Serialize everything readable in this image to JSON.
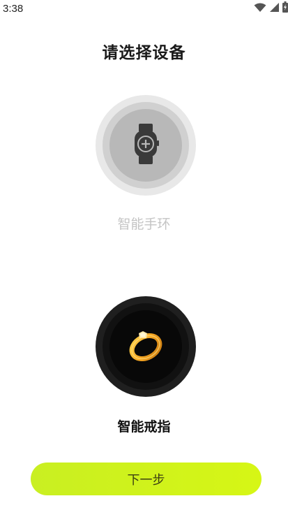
{
  "status_bar": {
    "time": "3:38",
    "icons": [
      "wifi-icon",
      "cellular-signal-icon",
      "battery-icon"
    ]
  },
  "page": {
    "title": "请选择设备"
  },
  "devices": [
    {
      "label": "智能手环",
      "icon": "watch-add-icon",
      "selected": false
    },
    {
      "label": "智能戒指",
      "icon": "ring-icon",
      "selected": true
    }
  ],
  "actions": {
    "next_label": "下一步"
  },
  "colors": {
    "accent": "#d0f218",
    "unselected_text": "#c4c4c4",
    "selected_text": "#111111"
  }
}
